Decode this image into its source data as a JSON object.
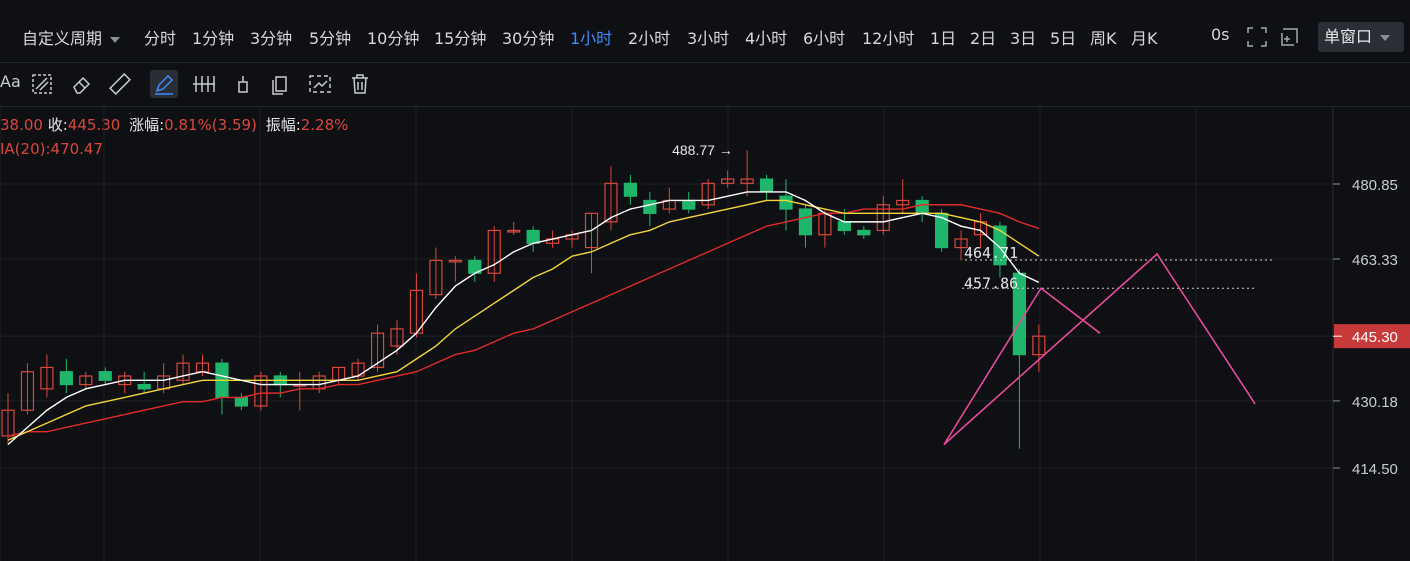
{
  "toolbar": {
    "custom_period": "自定义周期",
    "periods": [
      "分时",
      "1分钟",
      "3分钟",
      "5分钟",
      "10分钟",
      "15分钟",
      "30分钟",
      "1小时",
      "2小时",
      "3小时",
      "4小时",
      "6小时",
      "12小时",
      "1日",
      "2日",
      "3日",
      "5日",
      "周K",
      "月K"
    ],
    "active_period": "1小时",
    "countdown": "0s",
    "window_mode": "单窗口"
  },
  "drawing_tools": [
    "text-tool-icon",
    "pattern-tool-icon",
    "eraser-icon",
    "ruler-icon",
    "pen-icon",
    "parallel-lines-icon",
    "pin-icon",
    "copy-icon",
    "measure-icon",
    "trash-icon"
  ],
  "info": {
    "open_fragment": "38.00",
    "close_label": "收:",
    "close_value": "445.30",
    "change_label": "涨幅:",
    "change_value": "0.81%(3.59)",
    "amplitude_label": "振幅:",
    "amplitude_value": "2.28%",
    "ma_label": "IA(20):",
    "ma_value": "470.47"
  },
  "colors": {
    "up": "#d9473d",
    "down": "#1fb66c",
    "ma5": "#ffffff",
    "ma10": "#f2d53c",
    "ma20": "#e12b2b",
    "pink": "#e64a9a",
    "price_tag": "#c83a3a"
  },
  "chart_data": {
    "type": "candlestick",
    "y_ticks": [
      "480.85",
      "463.33",
      "445.30",
      "430.18",
      "414.50"
    ],
    "current_price": "445.30",
    "high_label": "488.77",
    "annotations": [
      "464.71",
      "457.86"
    ],
    "ylim": [
      406,
      500
    ],
    "candles": [
      {
        "o": 422,
        "c": 428,
        "h": 432,
        "l": 420
      },
      {
        "o": 428,
        "c": 437,
        "h": 439,
        "l": 427
      },
      {
        "o": 433,
        "c": 438,
        "h": 441,
        "l": 431
      },
      {
        "o": 437,
        "c": 434,
        "h": 440,
        "l": 432
      },
      {
        "o": 434,
        "c": 436,
        "h": 437,
        "l": 433
      },
      {
        "o": 437,
        "c": 435,
        "h": 438,
        "l": 434
      },
      {
        "o": 434,
        "c": 436,
        "h": 437,
        "l": 432
      },
      {
        "o": 434,
        "c": 433,
        "h": 437,
        "l": 432
      },
      {
        "o": 433,
        "c": 436,
        "h": 439,
        "l": 432
      },
      {
        "o": 435,
        "c": 439,
        "h": 441,
        "l": 434
      },
      {
        "o": 437,
        "c": 439,
        "h": 441,
        "l": 436
      },
      {
        "o": 439,
        "c": 431,
        "h": 440,
        "l": 427
      },
      {
        "o": 431,
        "c": 429,
        "h": 432,
        "l": 428
      },
      {
        "o": 429,
        "c": 436,
        "h": 437,
        "l": 428
      },
      {
        "o": 436,
        "c": 434,
        "h": 437,
        "l": 431
      },
      {
        "o": 434,
        "c": 434,
        "h": 437,
        "l": 428
      },
      {
        "o": 433,
        "c": 436,
        "h": 437,
        "l": 432
      },
      {
        "o": 435,
        "c": 438,
        "h": 438,
        "l": 434
      },
      {
        "o": 436,
        "c": 439,
        "h": 440,
        "l": 435
      },
      {
        "o": 438,
        "c": 446,
        "h": 448,
        "l": 437
      },
      {
        "o": 443,
        "c": 447,
        "h": 449,
        "l": 441
      },
      {
        "o": 446,
        "c": 456,
        "h": 460,
        "l": 445
      },
      {
        "o": 455,
        "c": 463,
        "h": 466,
        "l": 454
      },
      {
        "o": 463,
        "c": 463,
        "h": 464,
        "l": 458
      },
      {
        "o": 463,
        "c": 460,
        "h": 464,
        "l": 458
      },
      {
        "o": 460,
        "c": 470,
        "h": 471,
        "l": 458
      },
      {
        "o": 470,
        "c": 470,
        "h": 472,
        "l": 469
      },
      {
        "o": 470,
        "c": 467,
        "h": 471,
        "l": 465
      },
      {
        "o": 467,
        "c": 468,
        "h": 470,
        "l": 466
      },
      {
        "o": 468,
        "c": 469,
        "h": 470,
        "l": 466
      },
      {
        "o": 466,
        "c": 474,
        "h": 474,
        "l": 460
      },
      {
        "o": 472,
        "c": 481,
        "h": 485,
        "l": 470
      },
      {
        "o": 481,
        "c": 478,
        "h": 483,
        "l": 476
      },
      {
        "o": 477,
        "c": 474,
        "h": 479,
        "l": 471
      },
      {
        "o": 475,
        "c": 477,
        "h": 480,
        "l": 474
      },
      {
        "o": 477,
        "c": 475,
        "h": 479,
        "l": 474
      },
      {
        "o": 476,
        "c": 481,
        "h": 482,
        "l": 475
      },
      {
        "o": 481,
        "c": 482,
        "h": 484,
        "l": 480
      },
      {
        "o": 481,
        "c": 482,
        "h": 488.77,
        "l": 478
      },
      {
        "o": 482,
        "c": 479,
        "h": 483,
        "l": 477
      },
      {
        "o": 478,
        "c": 475,
        "h": 482,
        "l": 470
      },
      {
        "o": 475,
        "c": 469,
        "h": 476,
        "l": 466
      },
      {
        "o": 469,
        "c": 474,
        "h": 475,
        "l": 466
      },
      {
        "o": 472,
        "c": 470,
        "h": 475,
        "l": 469
      },
      {
        "o": 470,
        "c": 469,
        "h": 471,
        "l": 468
      },
      {
        "o": 470,
        "c": 476,
        "h": 478,
        "l": 469
      },
      {
        "o": 476,
        "c": 477,
        "h": 482,
        "l": 474
      },
      {
        "o": 477,
        "c": 474,
        "h": 478,
        "l": 472
      },
      {
        "o": 474,
        "c": 466,
        "h": 475,
        "l": 465
      },
      {
        "o": 466,
        "c": 468,
        "h": 470,
        "l": 463
      },
      {
        "o": 469,
        "c": 472,
        "h": 474,
        "l": 466
      },
      {
        "o": 471,
        "c": 462,
        "h": 472,
        "l": 459
      },
      {
        "o": 460,
        "c": 441,
        "h": 461,
        "l": 419
      },
      {
        "o": 441,
        "c": 445.3,
        "h": 448,
        "l": 437
      }
    ],
    "ma5": [
      420,
      424,
      428,
      431,
      433,
      434,
      435,
      435,
      435,
      436,
      437,
      436,
      435,
      434,
      434,
      434,
      434,
      435,
      436,
      439,
      442,
      446,
      452,
      457,
      460,
      462,
      465,
      467,
      468,
      469,
      470,
      473,
      475,
      476,
      477,
      477,
      477,
      478,
      479,
      479,
      479,
      477,
      474,
      472,
      472,
      472,
      473,
      474,
      473,
      471,
      470,
      466,
      460,
      457.86
    ],
    "ma10": [
      421,
      423,
      425,
      427,
      429,
      430,
      431,
      432,
      433,
      434,
      435,
      435,
      435,
      435,
      435,
      435,
      435,
      435,
      435,
      436,
      437,
      440,
      443,
      447,
      450,
      453,
      456,
      459,
      461,
      464,
      465,
      467,
      469,
      470,
      472,
      473,
      474,
      475,
      476,
      477,
      477,
      476,
      475,
      474,
      474,
      474,
      474,
      474,
      474,
      473,
      472,
      470,
      467,
      464
    ],
    "ma20": [
      422,
      423,
      423,
      424,
      425,
      426,
      427,
      428,
      429,
      430,
      430,
      431,
      431,
      432,
      432,
      433,
      433,
      434,
      434,
      435,
      436,
      437,
      439,
      441,
      442,
      444,
      446,
      447,
      449,
      451,
      453,
      455,
      457,
      459,
      461,
      463,
      465,
      467,
      469,
      471,
      472,
      473,
      474,
      474,
      475,
      475,
      475,
      476,
      476,
      476,
      475,
      474,
      472,
      470.47
    ]
  }
}
